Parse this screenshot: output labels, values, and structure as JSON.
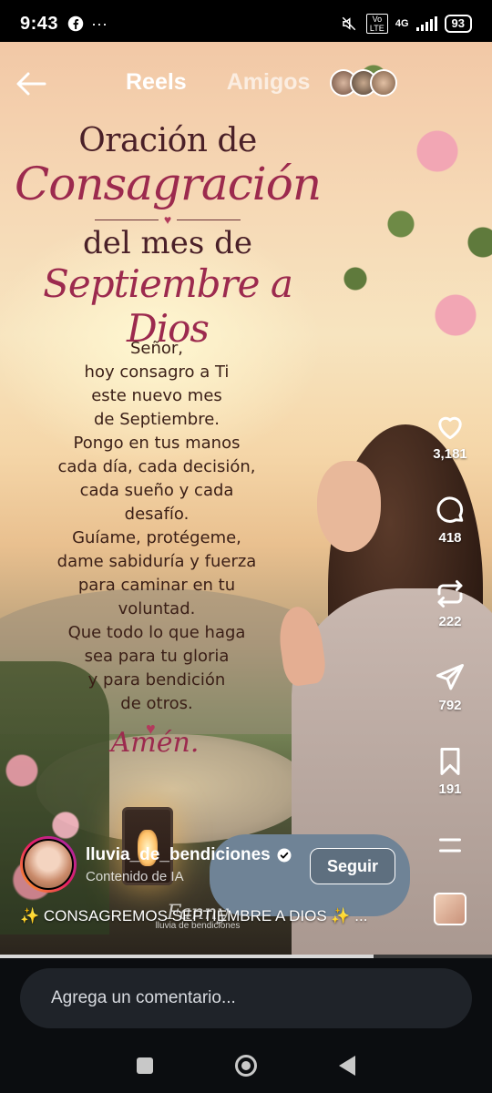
{
  "status_bar": {
    "time": "9:43",
    "battery": "93",
    "network": "4G",
    "volte": "Vo LTE",
    "left_icons": [
      "facebook-icon",
      "more-dots-icon"
    ]
  },
  "header": {
    "tabs": [
      {
        "label": "Reels",
        "active": true
      },
      {
        "label": "Amigos",
        "active": false
      }
    ]
  },
  "reel_image": {
    "title_line1": "Oración de",
    "title_line2": "Consagración",
    "title_line3": "del mes de",
    "title_line4": "Septiembre a Dios",
    "prayer_lines": [
      "Señor,",
      "hoy consagro a Ti",
      "este nuevo mes",
      "de Septiembre.",
      "Pongo en tus manos",
      "cada día, cada decisión,",
      "cada sueño y cada",
      "desafío.",
      "Guíame, protégeme,",
      "dame sabiduría y fuerza",
      "para caminar en tu",
      "voluntad.",
      "Que todo lo que haga",
      "sea para tu gloria",
      "y para bendición",
      "de otros."
    ],
    "amen": "Amén.",
    "watermark_sign": "Fanny",
    "watermark_sub": "lluvia de bendiciones"
  },
  "actions": {
    "likes": "3,181",
    "comments": "418",
    "reposts": "222",
    "shares": "792",
    "saves": "191"
  },
  "author": {
    "username": "lluvia_de_bendiciones",
    "verified": true,
    "label": "Contenido de IA",
    "follow_label": "Seguir"
  },
  "caption": "✨ CONSAGREMOS SEPTIEMBRE A DIOS ✨ ...",
  "video_progress": 0.76,
  "comment": {
    "placeholder": "Agrega un comentario..."
  },
  "colors": {
    "title_dark": "#4a2028",
    "title_accent": "#9c2a4e",
    "background": "#000000",
    "comment_bg": "#1f2329"
  }
}
